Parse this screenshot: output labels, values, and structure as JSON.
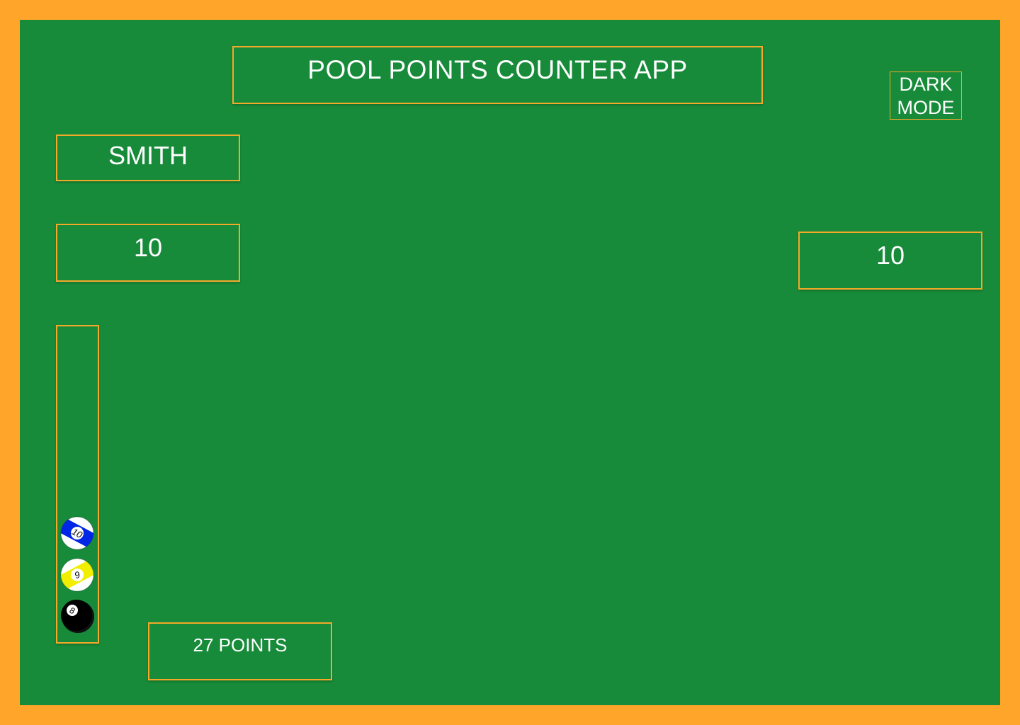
{
  "app": {
    "title": "POOL POINTS COUNTER APP",
    "dark_mode_button": "DARK MODE"
  },
  "player": {
    "name": "SMITH",
    "score_left": "10",
    "score_right": "10"
  },
  "rack": {
    "balls": [
      {
        "number": "10",
        "color": "#0026e6",
        "type": "stripe"
      },
      {
        "number": "9",
        "color": "#f2ee00",
        "type": "stripe"
      },
      {
        "number": "8",
        "color": "#000000",
        "type": "solid"
      }
    ]
  },
  "points_label": "27 POINTS",
  "colors": {
    "frame": "#ffa52a",
    "felt": "#178b3a",
    "border": "#f4a92a",
    "text": "#ffffff"
  }
}
